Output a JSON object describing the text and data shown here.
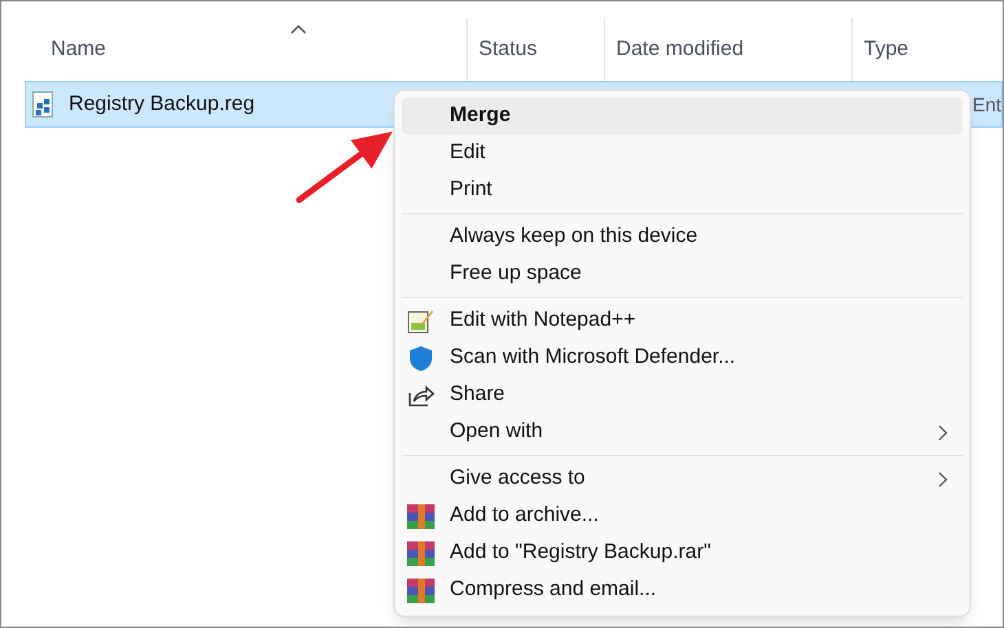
{
  "columns": [
    {
      "label": "Name",
      "sorted": true
    },
    {
      "label": "Status",
      "sorted": false
    },
    {
      "label": "Date modified",
      "sorted": false
    },
    {
      "label": "Type",
      "sorted": false
    }
  ],
  "rows": [
    {
      "name": "Registry Backup.reg",
      "type": "Ent",
      "selected": true
    }
  ],
  "context_menu": {
    "sections": [
      {
        "items": [
          {
            "label": "Merge",
            "kind": "plain",
            "default": true,
            "selected": true,
            "submenu": false
          },
          {
            "label": "Edit",
            "kind": "plain",
            "default": false,
            "selected": false,
            "submenu": false
          },
          {
            "label": "Print",
            "kind": "plain",
            "default": false,
            "selected": false,
            "submenu": false
          }
        ]
      },
      {
        "items": [
          {
            "label": "Always keep on this device",
            "kind": "plain",
            "default": false,
            "selected": false,
            "submenu": false
          },
          {
            "label": "Free up space",
            "kind": "plain",
            "default": false,
            "selected": false,
            "submenu": false
          }
        ]
      },
      {
        "items": [
          {
            "label": "Edit with Notepad++",
            "kind": "notepad",
            "default": false,
            "selected": false,
            "submenu": false
          },
          {
            "label": "Scan with Microsoft Defender...",
            "kind": "shield",
            "default": false,
            "selected": false,
            "submenu": false
          },
          {
            "label": "Share",
            "kind": "share",
            "default": false,
            "selected": false,
            "submenu": false
          },
          {
            "label": "Open with",
            "kind": "plain",
            "default": false,
            "selected": false,
            "submenu": true
          }
        ]
      },
      {
        "items": [
          {
            "label": "Give access to",
            "kind": "plain",
            "default": false,
            "selected": false,
            "submenu": true
          },
          {
            "label": "Add to archive...",
            "kind": "archive",
            "default": false,
            "selected": false,
            "submenu": false
          },
          {
            "label": "Add to \"Registry Backup.rar\"",
            "kind": "archive",
            "default": false,
            "selected": false,
            "submenu": false
          },
          {
            "label": "Compress and email...",
            "kind": "archive",
            "default": false,
            "selected": false,
            "submenu": false
          }
        ]
      }
    ]
  }
}
